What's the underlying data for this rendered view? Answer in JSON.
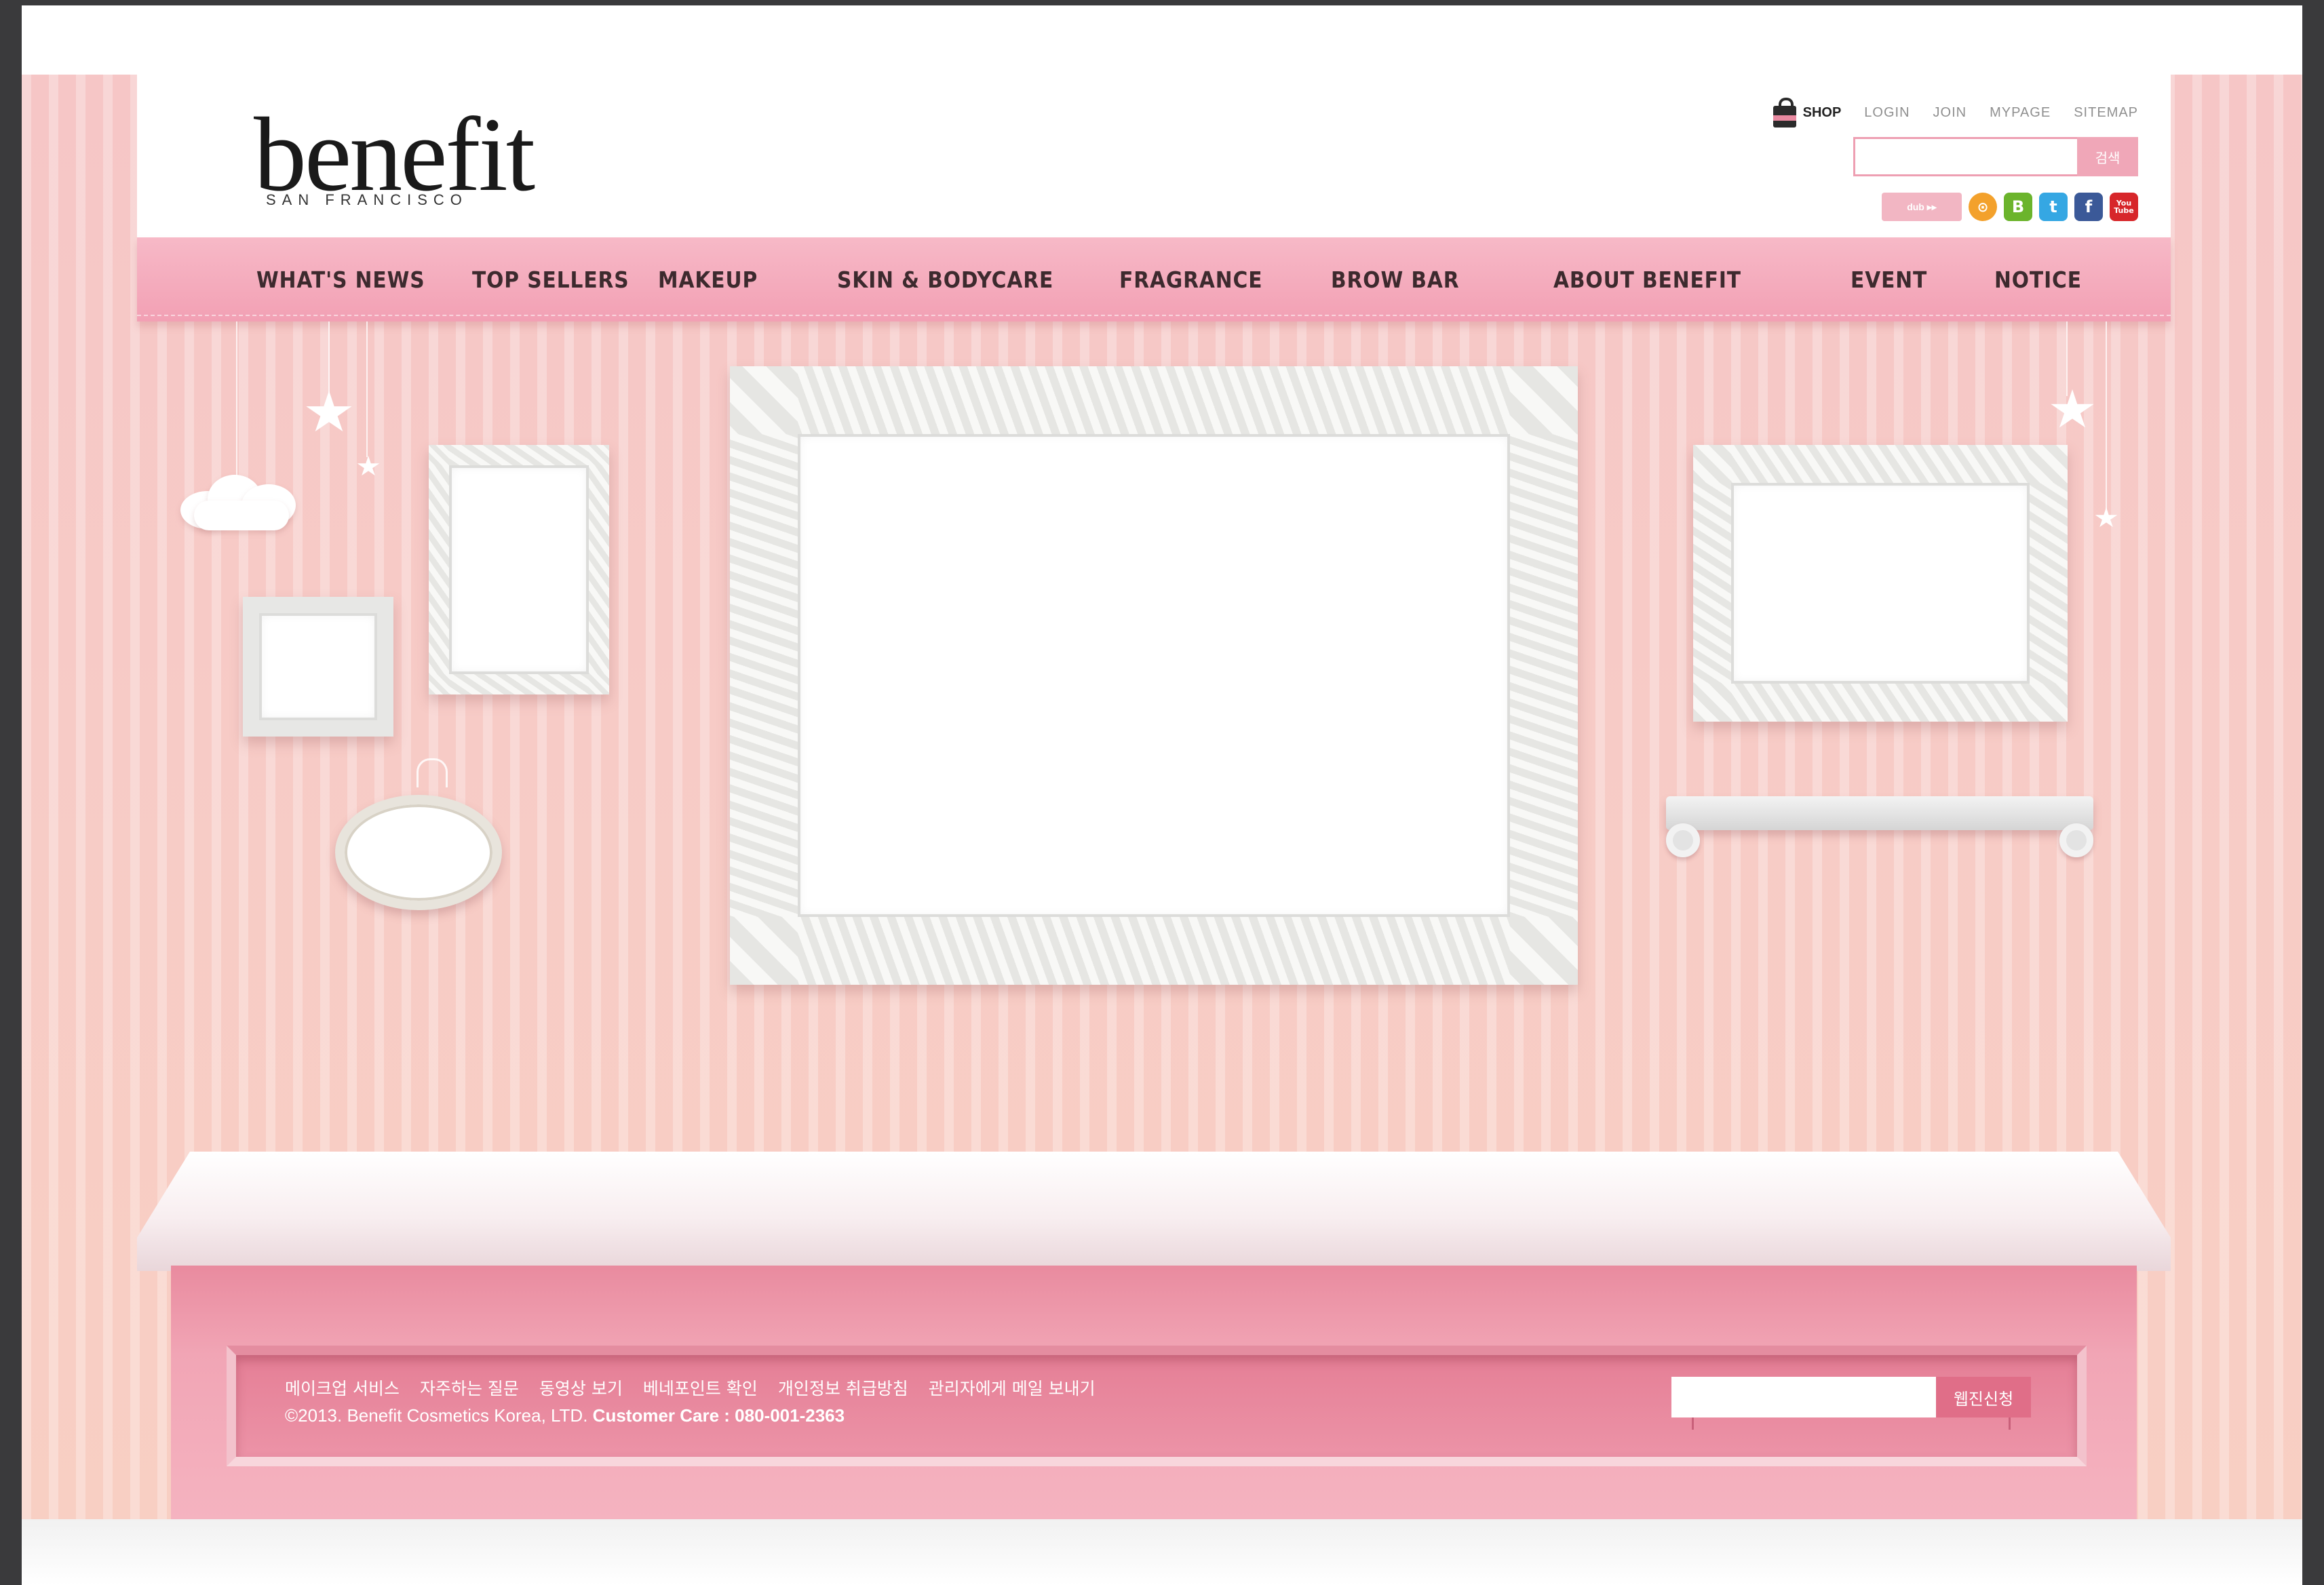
{
  "brand": {
    "name": "benefit",
    "tagline": "SAN FRANCISCO"
  },
  "utility_nav": {
    "shop": "SHOP",
    "login": "LOGIN",
    "join": "JOIN",
    "mypage": "MYPAGE",
    "sitemap": "SITEMAP"
  },
  "search": {
    "placeholder": "",
    "button": "검색"
  },
  "social": {
    "yes24_label": "dub ▸▸",
    "icons": [
      "me2day-icon",
      "blog-icon",
      "twitter-icon",
      "facebook-icon",
      "youtube-icon"
    ],
    "me2_glyph": "⊙",
    "blog_glyph": "B",
    "twitter_glyph": "t",
    "facebook_glyph": "f",
    "youtube_glyph": "You Tube"
  },
  "main_nav": [
    "WHAT'S NEWS",
    "TOP SELLERS",
    "MAKEUP",
    "SKIN & BODYCARE",
    "FRAGRANCE",
    "BROW BAR",
    "ABOUT BENEFIT",
    "EVENT",
    "NOTICE"
  ],
  "footer": {
    "links": [
      "메이크업 서비스",
      "자주하는 질문",
      "동영상 보기",
      "베네포인트 확인",
      "개인정보 취급방침",
      "관리자에게 메일 보내기"
    ],
    "copyright": "©2013. Benefit Cosmetics Korea, LTD.",
    "customer_care": "Customer Care : 080-001-2363",
    "newsletter_button": "웹진신청"
  },
  "colors": {
    "nav_pink": "#f2a0b4",
    "wall_peach": "#f7cbc6",
    "counter_pink": "#e98b9f",
    "text_dark": "#3d2a2e"
  }
}
